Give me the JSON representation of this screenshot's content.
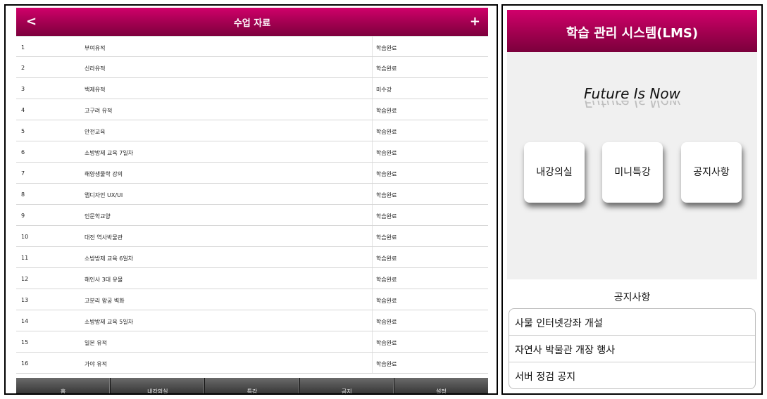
{
  "left": {
    "nav": {
      "back": "<",
      "title": "수업 자료",
      "add": "+"
    },
    "rows": [
      {
        "num": "1",
        "name": "부여유적",
        "status": "학습완료"
      },
      {
        "num": "2",
        "name": "신라유적",
        "status": "학습완료"
      },
      {
        "num": "3",
        "name": "백제유적",
        "status": "미수강"
      },
      {
        "num": "4",
        "name": "고구려 유적",
        "status": "학습완료"
      },
      {
        "num": "5",
        "name": "안전교육",
        "status": "학습완료"
      },
      {
        "num": "6",
        "name": "소방방제 교육 7일차",
        "status": "학습완료"
      },
      {
        "num": "7",
        "name": "해양생물학 강의",
        "status": "학습완료"
      },
      {
        "num": "8",
        "name": "앱디자인 UX/UI",
        "status": "학습완료"
      },
      {
        "num": "9",
        "name": "인문학교양",
        "status": "학습완료"
      },
      {
        "num": "10",
        "name": "대전 역사박물관",
        "status": "학습완료"
      },
      {
        "num": "11",
        "name": "소방방제 교육 6일차",
        "status": "학습완료"
      },
      {
        "num": "12",
        "name": "해인사 3대 유물",
        "status": "학습완료"
      },
      {
        "num": "13",
        "name": "고분리 왕궁 벽화",
        "status": "학습완료"
      },
      {
        "num": "14",
        "name": "소방방제 교육 5일차",
        "status": "학습완료"
      },
      {
        "num": "15",
        "name": "일본 유적",
        "status": "학습완료"
      },
      {
        "num": "16",
        "name": "가야 유적",
        "status": "학습완료"
      }
    ],
    "tabs": [
      "홈",
      "내강의실",
      "특강",
      "공지",
      "설정"
    ]
  },
  "right": {
    "header": "학습 관리 시스템(LMS)",
    "slogan": "Future Is Now",
    "tiles": [
      "내강의실",
      "미니특강",
      "공지사항"
    ],
    "notice_title": "공지사항",
    "notices": [
      "사물 인터넷강좌 개설",
      "자연사 박물관 개장 행사",
      "서버 정검 공지"
    ]
  },
  "colors": {
    "accent": "#a10050",
    "toolbar": "#3a3a3a"
  }
}
